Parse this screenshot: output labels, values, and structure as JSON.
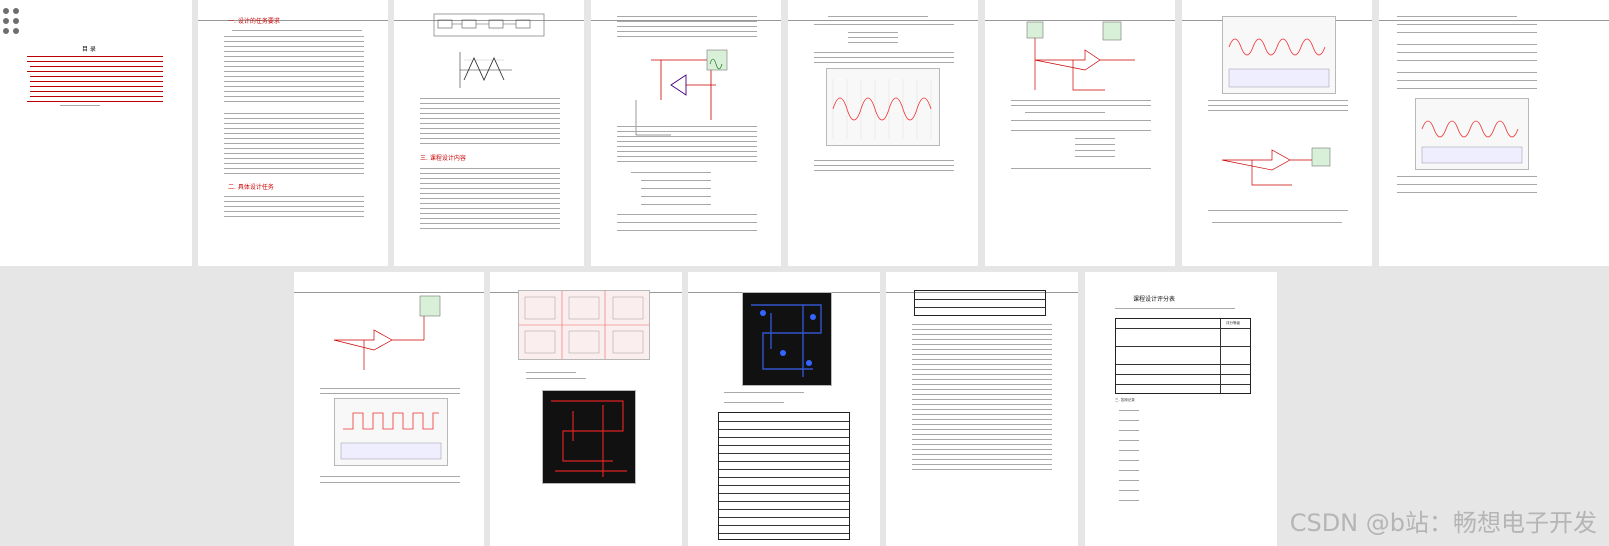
{
  "toc": {
    "title": "目 录"
  },
  "page2": {
    "heading1": "一. 设计的任务要求",
    "heading2": "二. 具体设计任务"
  },
  "page3": {
    "heading": "三. 课程设计内容"
  },
  "page_final": {
    "title": "课程设计评分表",
    "grade_label": "评分等级",
    "notes_label": "三. 答辩记录"
  },
  "watermark": "CSDN @b站：畅想电子开发"
}
